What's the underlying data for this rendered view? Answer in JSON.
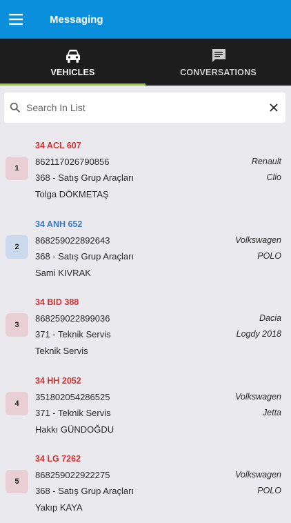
{
  "appbar": {
    "title": "Messaging"
  },
  "tabs": [
    {
      "label": "VEHICLES",
      "icon": "car-icon",
      "active": true
    },
    {
      "label": "CONVERSATIONS",
      "icon": "chat-icon",
      "active": false
    }
  ],
  "search": {
    "placeholder": "Search In List",
    "value": ""
  },
  "colors": {
    "primary": "#0a8fdc",
    "tabbar": "#1d1d1d",
    "indicator": "#9acd32",
    "plate_red": "#d13434",
    "plate_blue": "#3a78c3"
  },
  "vehicles": [
    {
      "index": "1",
      "plate": "34 ACL 607",
      "imei": "862117026790856",
      "group": "368 - Satış Grup Araçları",
      "driver": "Tolga DÖKMETAŞ",
      "make": "Renault",
      "model": "Clio"
    },
    {
      "index": "2",
      "plate": "34 ANH 652",
      "imei": "868259022892643",
      "group": "368 - Satış Grup Araçları",
      "driver": "Sami KIVRAK",
      "make": "Volkswagen",
      "model": "POLO"
    },
    {
      "index": "3",
      "plate": "34 BID 388",
      "imei": "868259022899036",
      "group": "371 - Teknik Servis",
      "driver": "Teknik Servis",
      "make": "Dacia",
      "model": "Logdy 2018"
    },
    {
      "index": "4",
      "plate": "34 HH 2052",
      "imei": "351802054286525",
      "group": "371 - Teknik Servis",
      "driver": "Hakkı GÜNDOĞDU",
      "make": "Volkswagen",
      "model": "Jetta"
    },
    {
      "index": "5",
      "plate": "34 LG 7262",
      "imei": "868259022922275",
      "group": "368 - Satış Grup Araçları",
      "driver": "Yakıp KAYA",
      "make": "Volkswagen",
      "model": "POLO"
    }
  ]
}
